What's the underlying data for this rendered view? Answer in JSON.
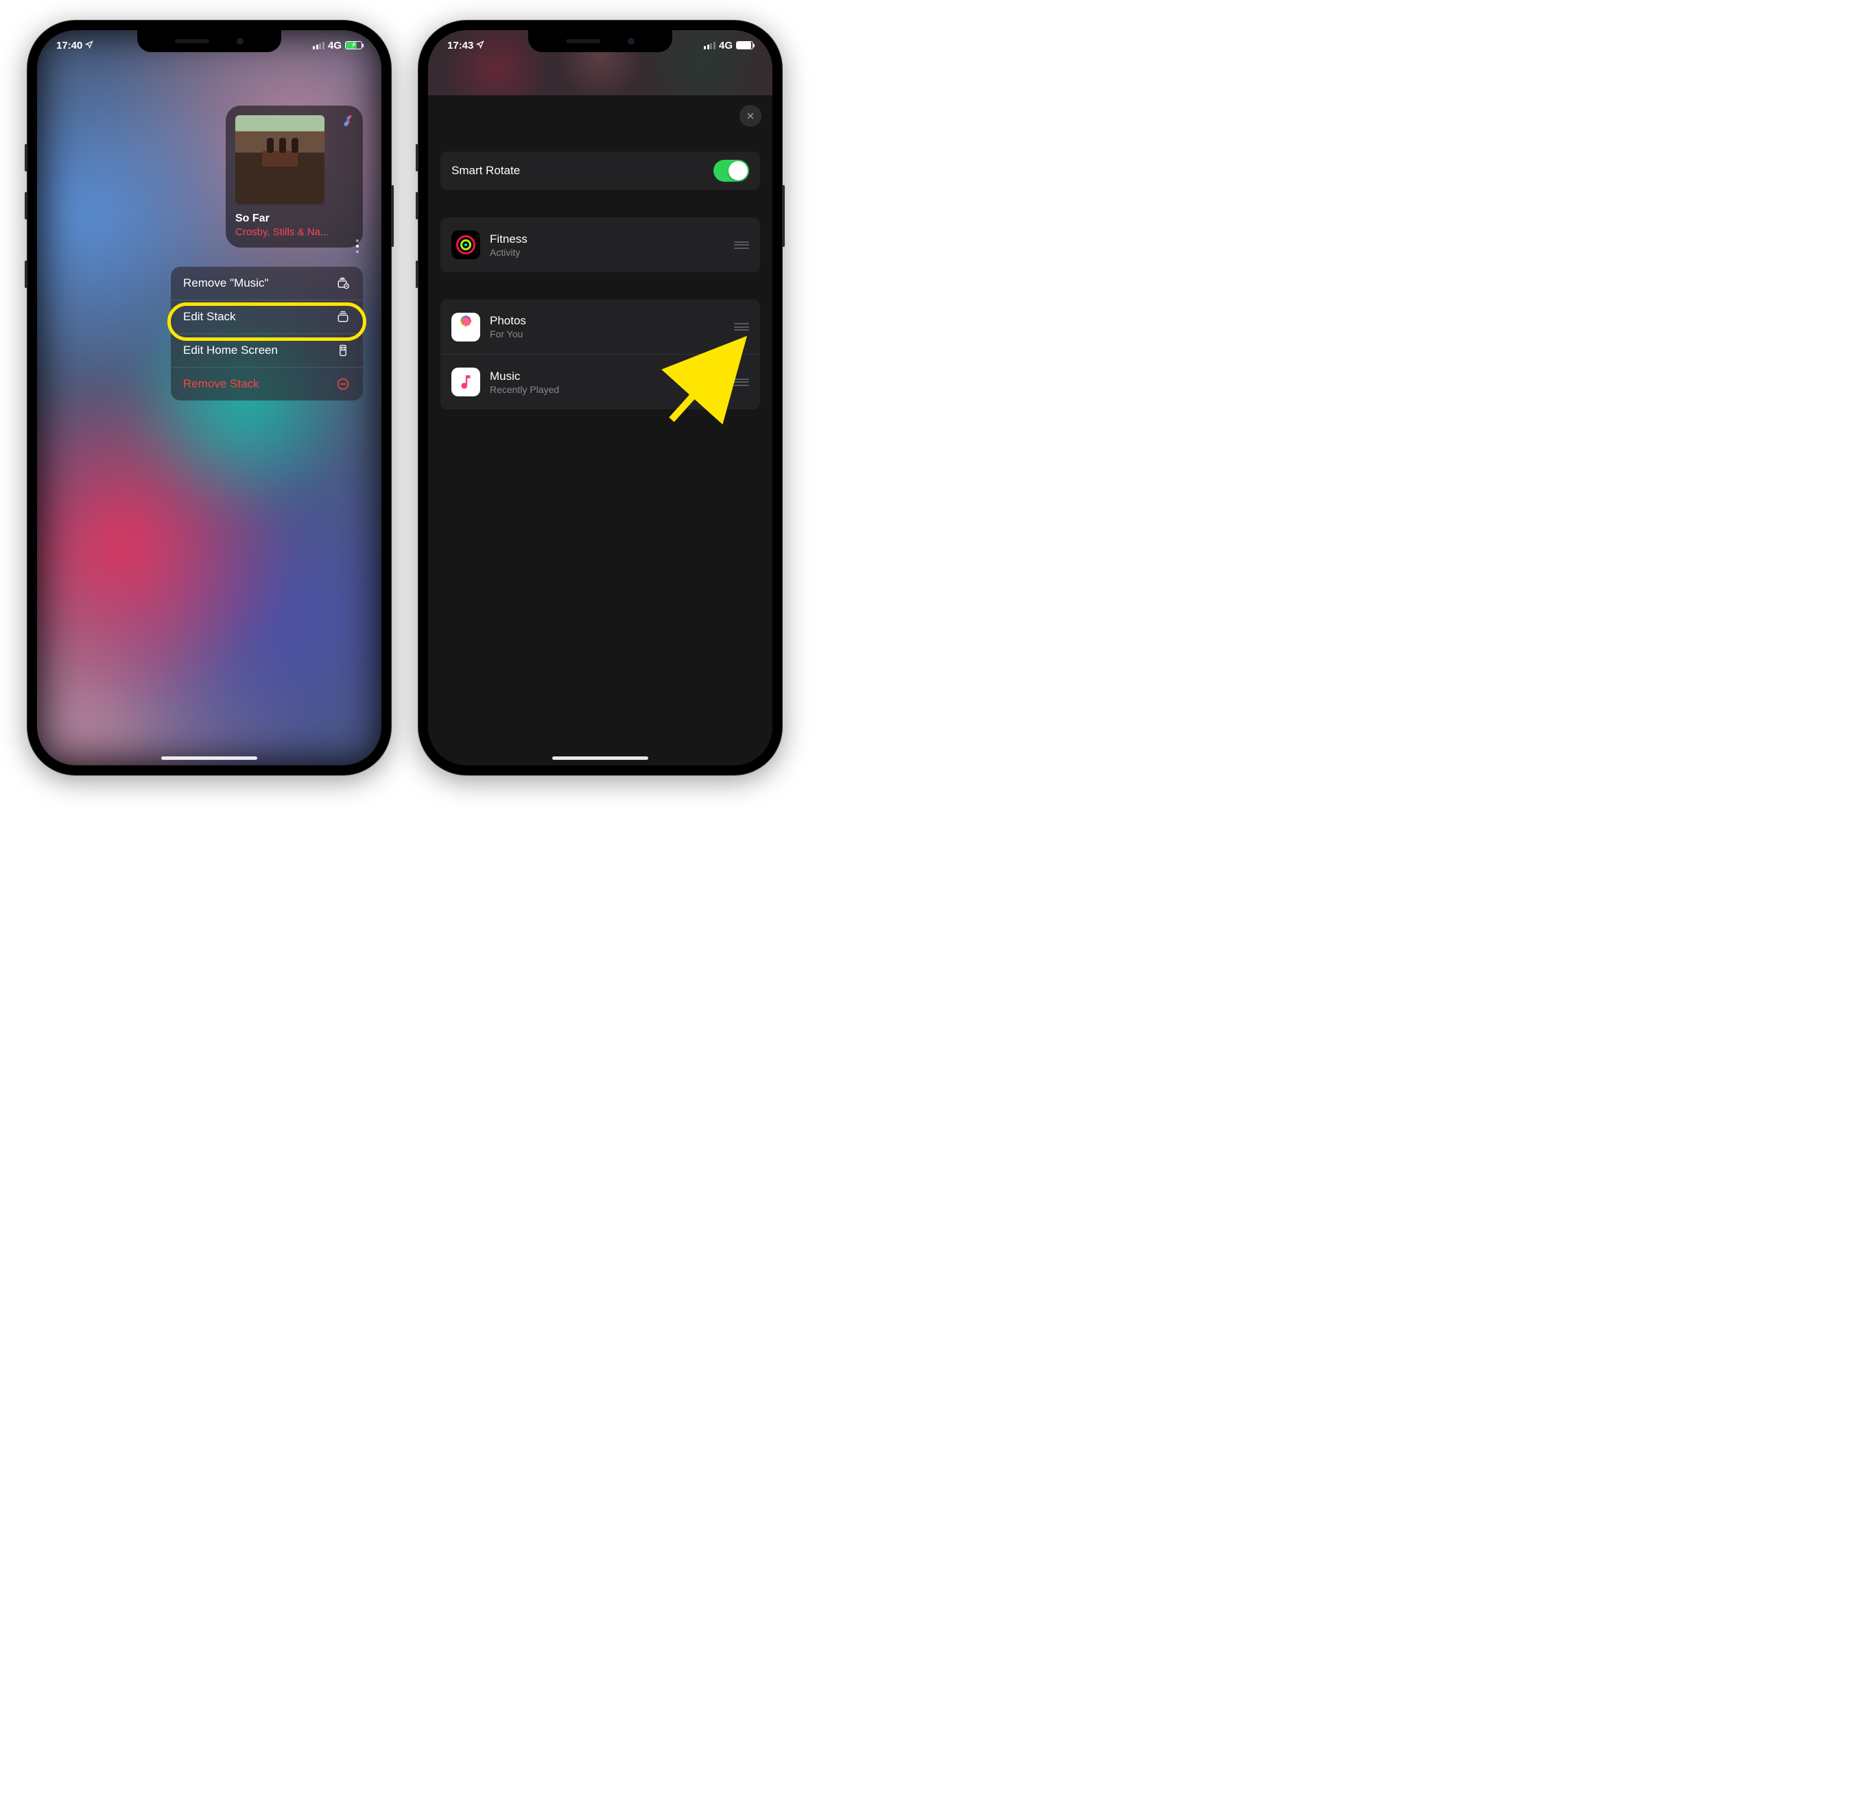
{
  "left": {
    "status": {
      "time": "17:40",
      "network": "4G"
    },
    "widget": {
      "trackTitle": "So Far",
      "artist": "Crosby, Stills & Na..."
    },
    "ctx": {
      "remove": "Remove \"Music\"",
      "editStack": "Edit Stack",
      "editHome": "Edit Home Screen",
      "removeStack": "Remove Stack"
    }
  },
  "right": {
    "status": {
      "time": "17:43",
      "network": "4G"
    },
    "smartRotate": "Smart Rotate",
    "items": {
      "fitness": {
        "title": "Fitness",
        "sub": "Activity"
      },
      "photos": {
        "title": "Photos",
        "sub": "For You"
      },
      "music": {
        "title": "Music",
        "sub": "Recently Played"
      }
    }
  }
}
